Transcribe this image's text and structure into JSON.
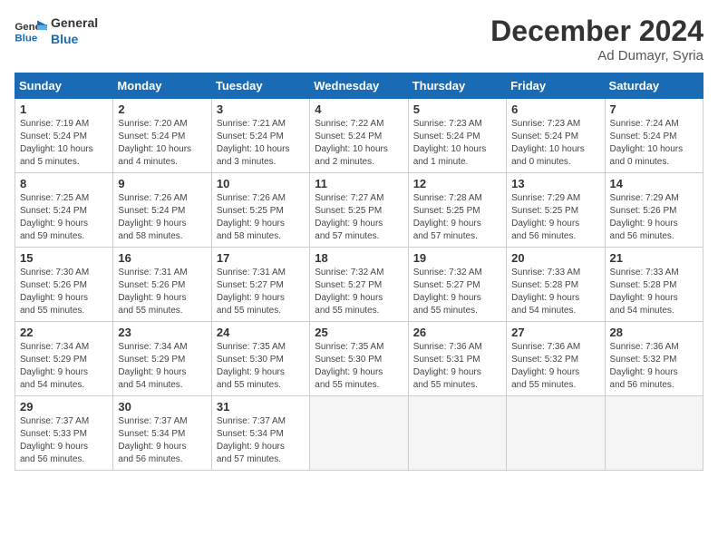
{
  "header": {
    "logo_line1": "General",
    "logo_line2": "Blue",
    "month": "December 2024",
    "location": "Ad Dumayr, Syria"
  },
  "weekdays": [
    "Sunday",
    "Monday",
    "Tuesday",
    "Wednesday",
    "Thursday",
    "Friday",
    "Saturday"
  ],
  "weeks": [
    [
      {
        "day": "1",
        "text": "Sunrise: 7:19 AM\nSunset: 5:24 PM\nDaylight: 10 hours\nand 5 minutes."
      },
      {
        "day": "2",
        "text": "Sunrise: 7:20 AM\nSunset: 5:24 PM\nDaylight: 10 hours\nand 4 minutes."
      },
      {
        "day": "3",
        "text": "Sunrise: 7:21 AM\nSunset: 5:24 PM\nDaylight: 10 hours\nand 3 minutes."
      },
      {
        "day": "4",
        "text": "Sunrise: 7:22 AM\nSunset: 5:24 PM\nDaylight: 10 hours\nand 2 minutes."
      },
      {
        "day": "5",
        "text": "Sunrise: 7:23 AM\nSunset: 5:24 PM\nDaylight: 10 hours\nand 1 minute."
      },
      {
        "day": "6",
        "text": "Sunrise: 7:23 AM\nSunset: 5:24 PM\nDaylight: 10 hours\nand 0 minutes."
      },
      {
        "day": "7",
        "text": "Sunrise: 7:24 AM\nSunset: 5:24 PM\nDaylight: 10 hours\nand 0 minutes."
      }
    ],
    [
      {
        "day": "8",
        "text": "Sunrise: 7:25 AM\nSunset: 5:24 PM\nDaylight: 9 hours\nand 59 minutes."
      },
      {
        "day": "9",
        "text": "Sunrise: 7:26 AM\nSunset: 5:24 PM\nDaylight: 9 hours\nand 58 minutes."
      },
      {
        "day": "10",
        "text": "Sunrise: 7:26 AM\nSunset: 5:25 PM\nDaylight: 9 hours\nand 58 minutes."
      },
      {
        "day": "11",
        "text": "Sunrise: 7:27 AM\nSunset: 5:25 PM\nDaylight: 9 hours\nand 57 minutes."
      },
      {
        "day": "12",
        "text": "Sunrise: 7:28 AM\nSunset: 5:25 PM\nDaylight: 9 hours\nand 57 minutes."
      },
      {
        "day": "13",
        "text": "Sunrise: 7:29 AM\nSunset: 5:25 PM\nDaylight: 9 hours\nand 56 minutes."
      },
      {
        "day": "14",
        "text": "Sunrise: 7:29 AM\nSunset: 5:26 PM\nDaylight: 9 hours\nand 56 minutes."
      }
    ],
    [
      {
        "day": "15",
        "text": "Sunrise: 7:30 AM\nSunset: 5:26 PM\nDaylight: 9 hours\nand 55 minutes."
      },
      {
        "day": "16",
        "text": "Sunrise: 7:31 AM\nSunset: 5:26 PM\nDaylight: 9 hours\nand 55 minutes."
      },
      {
        "day": "17",
        "text": "Sunrise: 7:31 AM\nSunset: 5:27 PM\nDaylight: 9 hours\nand 55 minutes."
      },
      {
        "day": "18",
        "text": "Sunrise: 7:32 AM\nSunset: 5:27 PM\nDaylight: 9 hours\nand 55 minutes."
      },
      {
        "day": "19",
        "text": "Sunrise: 7:32 AM\nSunset: 5:27 PM\nDaylight: 9 hours\nand 55 minutes."
      },
      {
        "day": "20",
        "text": "Sunrise: 7:33 AM\nSunset: 5:28 PM\nDaylight: 9 hours\nand 54 minutes."
      },
      {
        "day": "21",
        "text": "Sunrise: 7:33 AM\nSunset: 5:28 PM\nDaylight: 9 hours\nand 54 minutes."
      }
    ],
    [
      {
        "day": "22",
        "text": "Sunrise: 7:34 AM\nSunset: 5:29 PM\nDaylight: 9 hours\nand 54 minutes."
      },
      {
        "day": "23",
        "text": "Sunrise: 7:34 AM\nSunset: 5:29 PM\nDaylight: 9 hours\nand 54 minutes."
      },
      {
        "day": "24",
        "text": "Sunrise: 7:35 AM\nSunset: 5:30 PM\nDaylight: 9 hours\nand 55 minutes."
      },
      {
        "day": "25",
        "text": "Sunrise: 7:35 AM\nSunset: 5:30 PM\nDaylight: 9 hours\nand 55 minutes."
      },
      {
        "day": "26",
        "text": "Sunrise: 7:36 AM\nSunset: 5:31 PM\nDaylight: 9 hours\nand 55 minutes."
      },
      {
        "day": "27",
        "text": "Sunrise: 7:36 AM\nSunset: 5:32 PM\nDaylight: 9 hours\nand 55 minutes."
      },
      {
        "day": "28",
        "text": "Sunrise: 7:36 AM\nSunset: 5:32 PM\nDaylight: 9 hours\nand 56 minutes."
      }
    ],
    [
      {
        "day": "29",
        "text": "Sunrise: 7:37 AM\nSunset: 5:33 PM\nDaylight: 9 hours\nand 56 minutes."
      },
      {
        "day": "30",
        "text": "Sunrise: 7:37 AM\nSunset: 5:34 PM\nDaylight: 9 hours\nand 56 minutes."
      },
      {
        "day": "31",
        "text": "Sunrise: 7:37 AM\nSunset: 5:34 PM\nDaylight: 9 hours\nand 57 minutes."
      },
      null,
      null,
      null,
      null
    ]
  ]
}
